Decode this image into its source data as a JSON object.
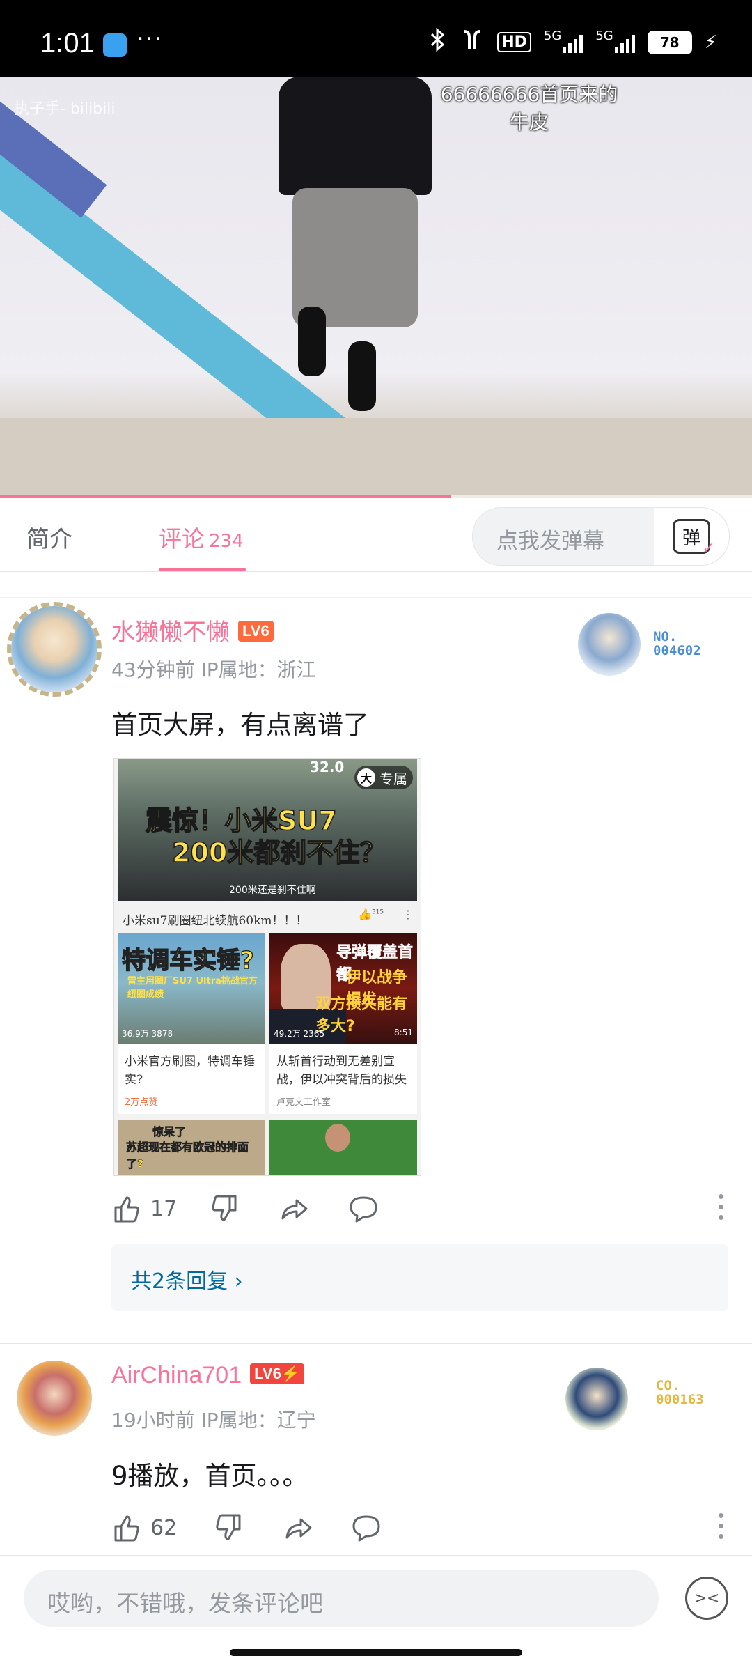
{
  "status_bar": {
    "time": "1:01",
    "more": "···",
    "network1": "5G",
    "network2": "5G",
    "hd": "HD",
    "battery": "78"
  },
  "video": {
    "uploader_watermark": "执子手- bilibili",
    "danmaku": "66666666首页来的\n牛皮",
    "progress_percent": 60
  },
  "tabs": {
    "intro": "简介",
    "comments": "评论",
    "comments_count": "234"
  },
  "danmaku_input": {
    "placeholder": "点我发弹幕",
    "button_label": "弹"
  },
  "comments": [
    {
      "username": "水獭懒不懒",
      "level": "LV6",
      "meta": "43分钟前 IP属地：浙江",
      "text": "首页大屏，有点离谱了",
      "fan_badge_label": "NO.",
      "fan_badge_number": "004602",
      "likes": "17",
      "replies": "共2条回复 ›",
      "screenshot": {
        "hero_line1": "震惊！小米SU7",
        "hero_line2": "200米都刹不住？",
        "hero_speed": "32.0",
        "hero_sub": "200米还是刹不住啊",
        "exclusive_badge": "大",
        "exclusive_label": "专属",
        "hero_caption": "小米su7刷圈纽北续航60km！！！",
        "hero_like": "315",
        "card1_big": "特调车实锤?",
        "card1_tiny": "雷主用圈厂SU7 Ultra挑战官方纽圈成绩",
        "card1_stats": "36.9万   3878",
        "card1_title": "小米官方刷图，特调车锤实?",
        "card1_small": "2万点赞",
        "card2_t1": "导弹覆盖首都",
        "card2_t2": "伊以战争爆发",
        "card2_t3": "双方损失能有多大?",
        "card2_stats": "49.2万   2365",
        "card2_dur": "8:51",
        "card2_title": "从斩首行动到无差别宣战，伊以冲突背后的损失",
        "card2_small": "卢克文工作室",
        "card3_t": "惊呆了",
        "card3_t2": "苏超现在都有欧冠的排面了?"
      }
    },
    {
      "username": "AirChina701",
      "level": "LV6⚡",
      "meta": "19小时前 IP属地：辽宁",
      "text": "9播放，首页。。。",
      "fan_badge_label": "CO.",
      "fan_badge_number": "000163",
      "likes": "62"
    }
  ],
  "comment_input": {
    "placeholder": "哎哟，不错哦，发条评论吧"
  },
  "colors": {
    "accent": "#fb7299",
    "reply_link": "#00699d",
    "level_badge": "#ff6a3d"
  },
  "icons": [
    "bluetooth-icon",
    "earbuds-icon",
    "signal-icon",
    "battery-icon",
    "like-icon",
    "dislike-icon",
    "share-icon",
    "reply-icon",
    "more-icon",
    "emoji-icon",
    "danmaku-icon"
  ]
}
